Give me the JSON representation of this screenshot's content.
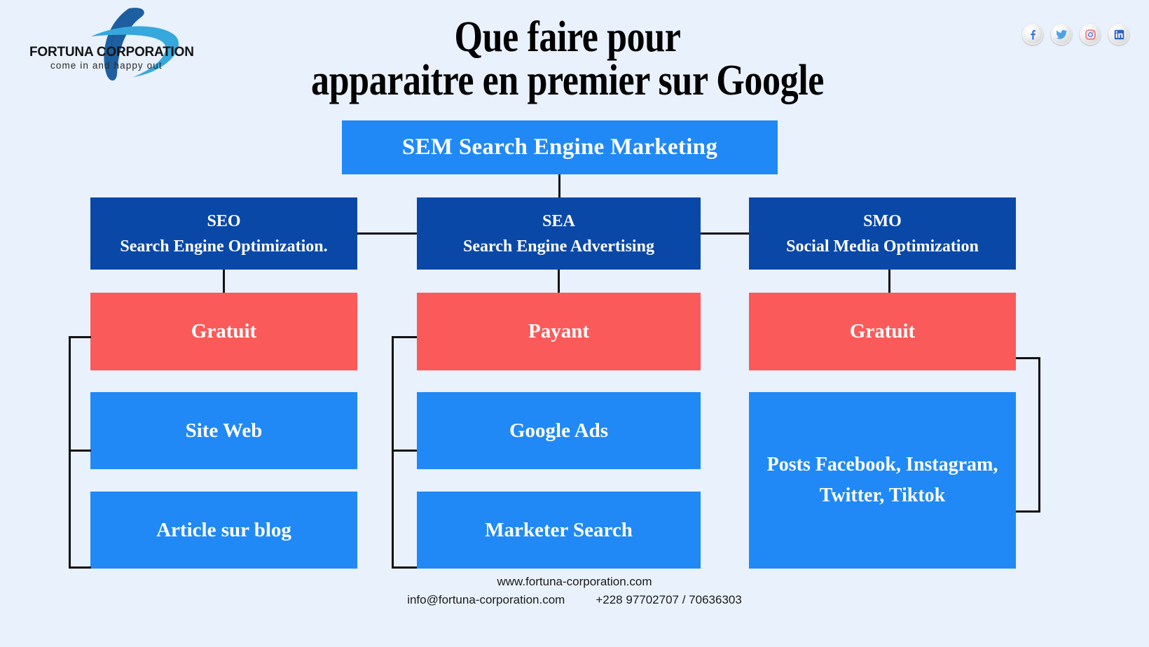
{
  "brand": {
    "logo_name": "FORTUNA CORPORATION",
    "logo_tagline": "come in and happy out"
  },
  "header": {
    "title": "Que faire pour\napparaitre en premier sur Google"
  },
  "social": {
    "items": [
      {
        "name": "facebook-icon",
        "label": "Facebook"
      },
      {
        "name": "twitter-icon",
        "label": "Twitter"
      },
      {
        "name": "instagram-icon",
        "label": "Instagram"
      },
      {
        "name": "linkedin-icon",
        "label": "LinkedIn"
      }
    ]
  },
  "diagram": {
    "root": {
      "label": "SEM Search Engine Marketing",
      "color": "#2089f5"
    },
    "columns": [
      {
        "key": "seo",
        "heading_line1": "SEO",
        "heading_line2": "Search Engine Optimization.",
        "heading_color": "#0a48a8",
        "cost": "Gratuit",
        "cost_color": "#fb5a5a",
        "items": [
          "Site Web",
          "Article sur blog"
        ],
        "item_color": "#2089f5"
      },
      {
        "key": "sea",
        "heading_line1": "SEA",
        "heading_line2": "Search Engine Advertising",
        "heading_color": "#0a48a8",
        "cost": "Payant",
        "cost_color": "#fb5a5a",
        "items": [
          "Google Ads",
          "Marketer Search"
        ],
        "item_color": "#2089f5"
      },
      {
        "key": "smo",
        "heading_line1": "SMO",
        "heading_line2": "Social Media Optimization",
        "heading_color": "#0a48a8",
        "cost": "Gratuit",
        "cost_color": "#fb5a5a",
        "items": [
          "Posts Facebook, Instagram, Twitter, Tiktok"
        ],
        "item_color": "#2089f5"
      }
    ]
  },
  "footer": {
    "website": "www.fortuna-corporation.com",
    "email": "info@fortuna-corporation.com",
    "phone": "+228 97702707 / 70636303"
  },
  "colors": {
    "background": "#e9f1fd",
    "navy": "#0a48a8",
    "blue": "#2089f5",
    "red": "#fb5a5a",
    "line": "#111111",
    "text_on_box": "#ffffff"
  }
}
